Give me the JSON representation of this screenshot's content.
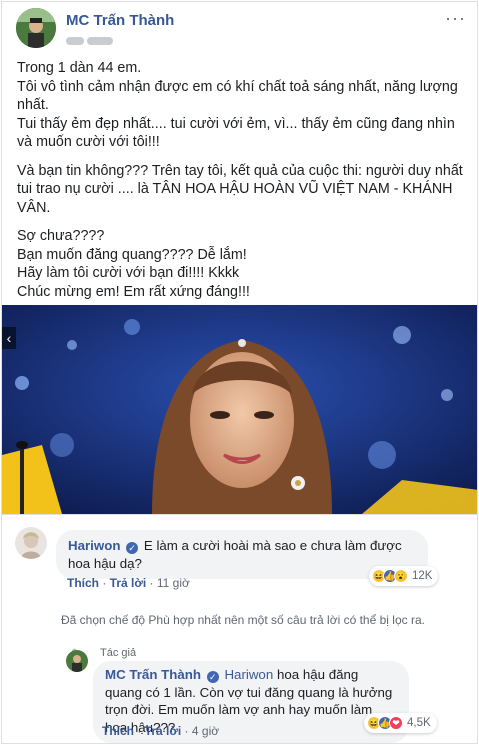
{
  "post": {
    "author": "MC Trấn Thành",
    "more_icon": "···",
    "paragraphs": [
      [
        "Trong 1 dàn 44 em.",
        "Tôi vô tình cảm nhận được em có khí chất toả sáng nhất, năng lượng nhất.",
        "Tui thấy ẻm đẹp nhất.... tui cười với ẻm, vì... thấy ẻm cũng đang nhìn và muốn cười với tôi!!!"
      ],
      [
        "Và bạn tin không??? Trên tay tôi, kết quả của cuộc thi: người duy nhất tui trao nụ cười .... là TÂN HOA HẬU HOÀN VŨ VIỆT NAM - KHÁNH VÂN."
      ],
      [
        "Sợ chưa????",
        "Bạn muốn đăng quang???? Dễ lắm!",
        "Hãy làm tôi cười với bạn đi!!!! Kkkk",
        "Chúc mừng em! Em rất xứng đáng!!!"
      ]
    ]
  },
  "photo": {
    "arrow": "‹"
  },
  "comments": [
    {
      "author": "Hariwon",
      "text": "E làm a cười hoài mà sao e chưa làm được hoa hậu dạ?",
      "like": "Thích",
      "reply": "Trả lời",
      "time": "11 giờ",
      "reactions": [
        "😆",
        "👍",
        "😮"
      ],
      "reaction_count": "12K"
    }
  ],
  "filter_note": "Đã chọn chế độ Phù hợp nhất nên một số câu trả lời có thể bị lọc ra.",
  "reply": {
    "badge": "Tác giả",
    "author": "MC Trấn Thành",
    "mention": "Hariwon",
    "text": "hoa hậu đăng quang có 1 lần. Còn vợ tui đăng quang là hưởng trọn đời. Em muốn làm vợ anh hay muốn làm hoa hậu???",
    "like": "Thích",
    "reply": "Trả lời",
    "time": "4 giờ",
    "reactions": [
      "😆",
      "👍",
      "❤"
    ],
    "reaction_count": "4,5K"
  },
  "colors": {
    "link": "#385898",
    "verified": "#4267b2",
    "bubble": "#f2f3f5"
  }
}
